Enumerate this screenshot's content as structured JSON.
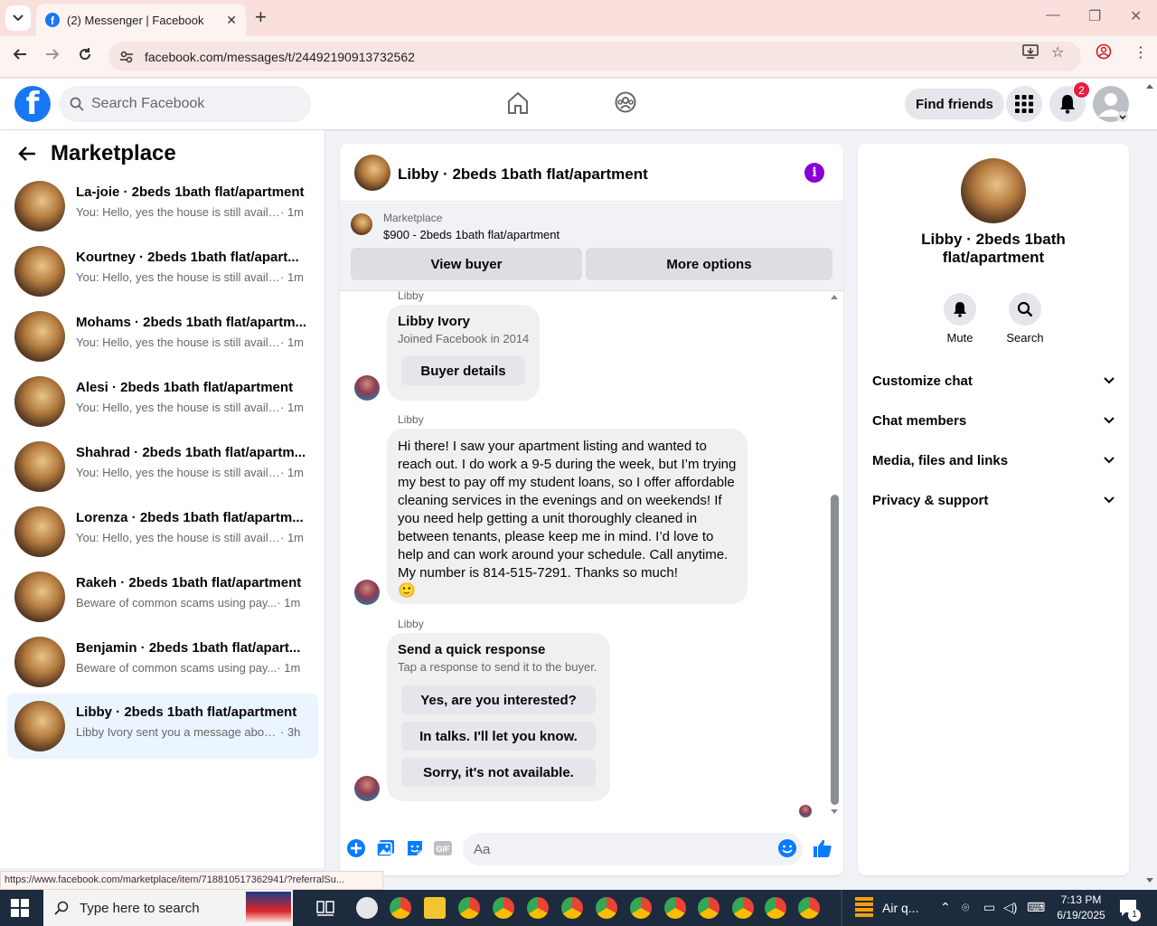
{
  "browser": {
    "tab_title": "(2) Messenger | Facebook",
    "url": "facebook.com/messages/t/24492190913732562",
    "status_url": "https://www.facebook.com/marketplace/item/718810517362941/?referralSu..."
  },
  "fb_header": {
    "search_placeholder": "Search Facebook",
    "find_friends": "Find friends",
    "notif_count": "2"
  },
  "left": {
    "title": "Marketplace",
    "conversations": [
      {
        "name": "La-joie · 2beds 1bath flat/apartment",
        "snippet": "You: Hello, yes the house is still availa...",
        "time": "· 1m"
      },
      {
        "name": "Kourtney · 2beds 1bath flat/apart...",
        "snippet": "You: Hello, yes the house is still availa...",
        "time": "· 1m"
      },
      {
        "name": "Mohams · 2beds 1bath flat/apartm...",
        "snippet": "You: Hello, yes the house is still availa...",
        "time": "· 1m"
      },
      {
        "name": "Alesi · 2beds 1bath flat/apartment",
        "snippet": "You: Hello, yes the house is still availa...",
        "time": "· 1m"
      },
      {
        "name": "Shahrad · 2beds 1bath flat/apartm...",
        "snippet": "You: Hello, yes the house is still availa...",
        "time": "· 1m"
      },
      {
        "name": "Lorenza · 2beds 1bath flat/apartm...",
        "snippet": "You: Hello, yes the house is still availa...",
        "time": "· 1m"
      },
      {
        "name": "Rakeh · 2beds 1bath flat/apartment",
        "snippet": "Beware of common scams using pay...",
        "time": "· 1m"
      },
      {
        "name": "Benjamin · 2beds 1bath flat/apart...",
        "snippet": "Beware of common scams using pay...",
        "time": "· 1m"
      },
      {
        "name": "Libby · 2beds 1bath flat/apartment",
        "snippet": "Libby Ivory sent you a message about...",
        "time": "· 3h"
      }
    ]
  },
  "chat": {
    "title": "Libby · 2beds 1bath flat/apartment",
    "marketplace_label": "Marketplace",
    "listing": "$900 - 2beds 1bath flat/apartment",
    "view_buyer": "View buyer",
    "more_options": "More options",
    "sender": "Libby",
    "card_name": "Libby Ivory",
    "card_sub": "Joined Facebook in 2014",
    "buyer_details": "Buyer details",
    "message": "Hi there! I saw your apartment listing and wanted to reach out. I do work a 9-5 during the week, but I’m trying my best to pay off my student loans, so I offer affordable cleaning services in the evenings and on weekends! If you need help getting a unit thoroughly cleaned in between tenants, please keep me in mind. I’d love to help and can work around your schedule. Call anytime. My number is 814-515-7291. Thanks so much!",
    "emoji": "🙂",
    "quick_title": "Send a quick response",
    "quick_sub": "Tap a response to send it to the buyer.",
    "quick_options": [
      "Yes, are you interested?",
      "In talks. I'll let you know.",
      "Sorry, it's not available."
    ],
    "composer_placeholder": "Aa"
  },
  "right": {
    "name": "Libby · 2beds 1bath flat/apartment",
    "mute": "Mute",
    "search": "Search",
    "sections": [
      "Customize chat",
      "Chat members",
      "Media, files and links",
      "Privacy & support"
    ]
  },
  "taskbar": {
    "search_placeholder": "Type here to search",
    "weather": "Air q...",
    "time": "7:13 PM",
    "date": "6/19/2025",
    "notif": "1"
  },
  "colors": {
    "fb_blue": "#1877f2",
    "accent_purple": "#8a00d4",
    "active_row": "#ebf5ff"
  }
}
